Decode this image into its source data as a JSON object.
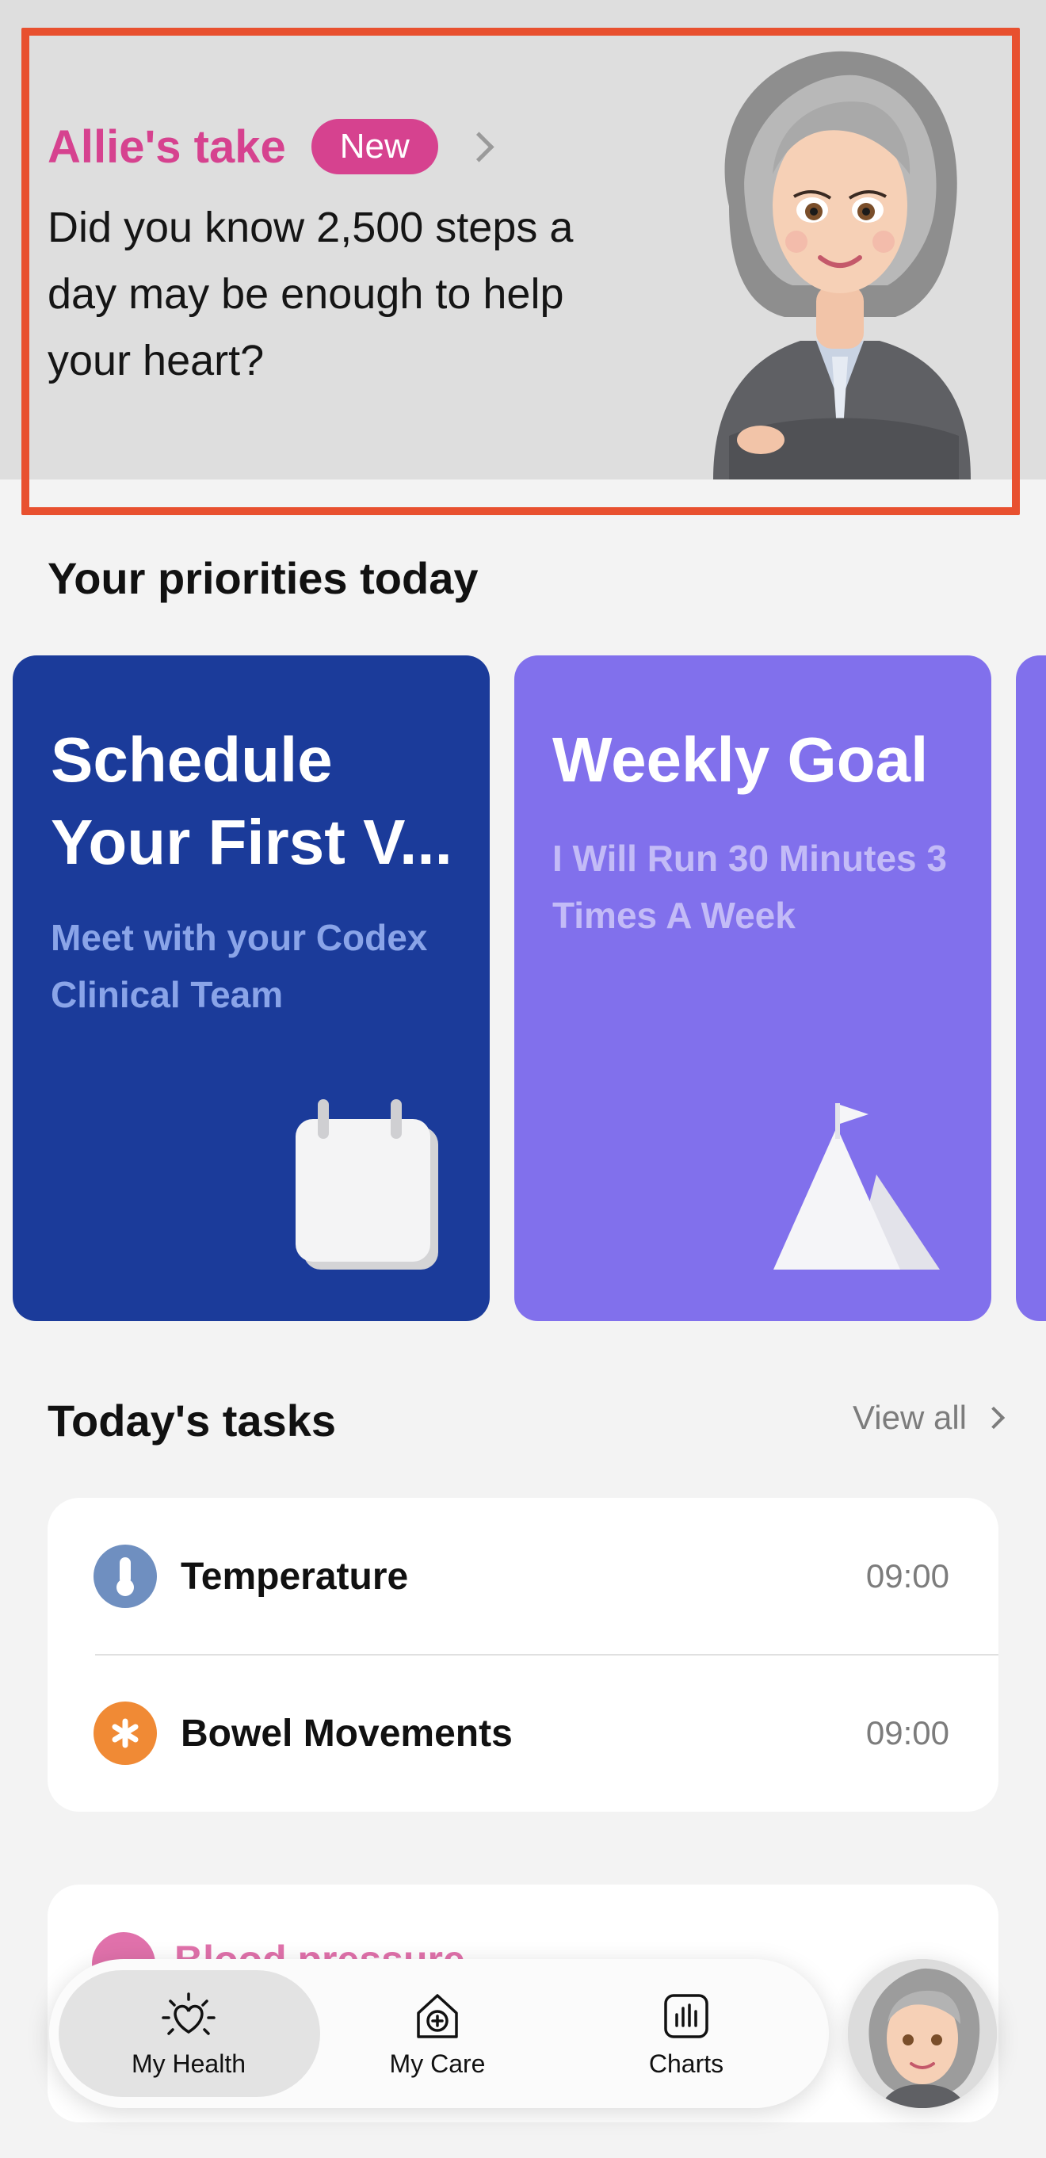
{
  "banner": {
    "title": "Allie's take",
    "badge": "New",
    "message": "Did you know 2,500 steps a day may be enough to help your heart?"
  },
  "priorities": {
    "heading": "Your priorities today",
    "cards": [
      {
        "title": "Schedule Your First V...",
        "subtitle": "Meet with your Codex Clinical Team",
        "color": "#1b3b9a",
        "icon": "calendar-icon"
      },
      {
        "title": "Weekly Goal",
        "subtitle": "I Will Run 30 Minutes 3 Times A Week",
        "color": "#8170ec",
        "icon": "mountain-flag-icon"
      }
    ]
  },
  "tasks": {
    "heading": "Today's tasks",
    "view_all": "View all",
    "items": [
      {
        "name": "Temperature",
        "time": "09:00",
        "icon": "thermometer-icon",
        "color": "#6f8fc0"
      },
      {
        "name": "Bowel Movements",
        "time": "09:00",
        "icon": "asterisk-icon",
        "color": "#f08a35"
      }
    ]
  },
  "partial_card": {
    "label": "Blood pressure"
  },
  "nav": {
    "items": [
      {
        "label": "My Health",
        "icon": "heart-sun-icon",
        "selected": true
      },
      {
        "label": "My Care",
        "icon": "house-plus-icon",
        "selected": false
      },
      {
        "label": "Charts",
        "icon": "bar-chart-icon",
        "selected": false
      }
    ]
  },
  "colors": {
    "accent": "#d6428f",
    "highlight_frame": "#e8502f"
  }
}
